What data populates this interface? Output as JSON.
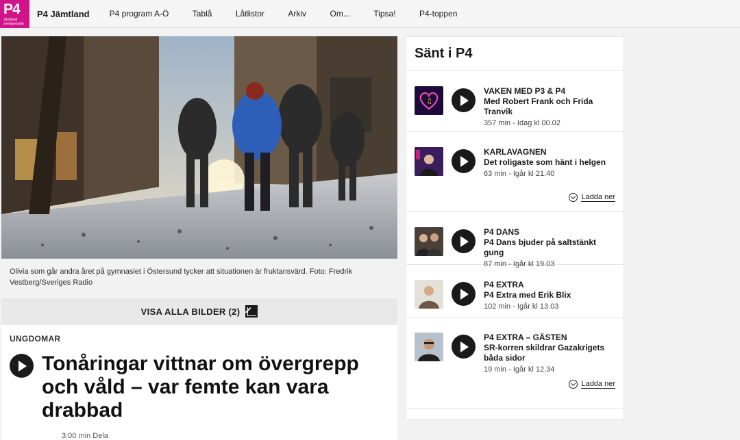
{
  "header": {
    "logo_text": "P4",
    "logo_sub": "Jämtland sverigesradio",
    "station": "P4 Jämtland",
    "nav": [
      "P4 program A-Ö",
      "Tablå",
      "Låtlistor",
      "Arkiv",
      "Om...",
      "Tipsa!",
      "P4-toppen"
    ]
  },
  "article": {
    "caption": "Olivia som går andra året på gymnasiet i Östersund tycker att situationen är fruktansvärd. Foto: Fredrik Vestberg/Sveriges Radio",
    "show_all_label": "VISA ALLA BILDER (2)",
    "category": "UNGDOMAR",
    "headline": "Tonåringar vittnar om övergrepp och våld – var femte kan vara drabbad",
    "duration": "3:00 min",
    "share_label": "Dela"
  },
  "sidebar": {
    "title": "Sänt i P4",
    "download_label": "Ladda ner",
    "episodes": [
      {
        "program": "VAKEN MED P3 & P4",
        "title": "Med Robert Frank och Frida Tranvik",
        "length": "357 min",
        "time": "Idag kl 00.02",
        "download": false
      },
      {
        "program": "KARLAVAGNEN",
        "title": "Det roligaste som hänt i helgen",
        "length": "63 min",
        "time": "Igår kl 21.40",
        "download": true
      },
      {
        "program": "P4 DANS",
        "title": "P4 Dans bjuder på saltstänkt gung",
        "length": "87 min",
        "time": "Igår kl 19.03",
        "download": false
      },
      {
        "program": "P4 EXTRA",
        "title": "P4 Extra med Erik Blix",
        "length": "102 min",
        "time": "Igår kl 13.03",
        "download": false
      },
      {
        "program": "P4 EXTRA – GÄSTEN",
        "title": "SR-korren skildrar Gazakrigets båda sidor",
        "length": "19 min",
        "time": "Igår kl 12.34",
        "download": true
      }
    ]
  },
  "colors": {
    "brand": "#d2148c",
    "dark": "#1a1a1a"
  }
}
